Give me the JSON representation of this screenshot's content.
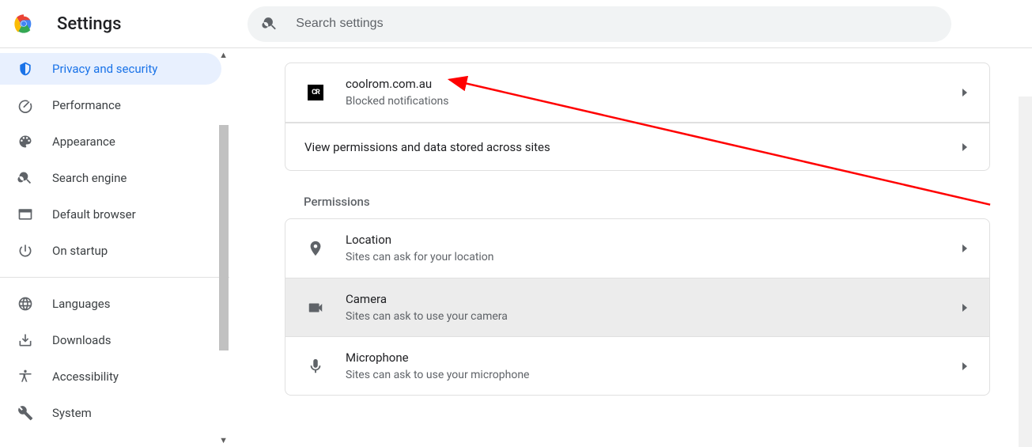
{
  "header": {
    "title": "Settings",
    "search_placeholder": "Search settings"
  },
  "sidebar": {
    "items": [
      {
        "id": "privacy",
        "label": "Privacy and security",
        "selected": true,
        "icon": "shield"
      },
      {
        "id": "performance",
        "label": "Performance",
        "selected": false,
        "icon": "speed"
      },
      {
        "id": "appearance",
        "label": "Appearance",
        "selected": false,
        "icon": "palette"
      },
      {
        "id": "search-engine",
        "label": "Search engine",
        "selected": false,
        "icon": "search"
      },
      {
        "id": "default-browser",
        "label": "Default browser",
        "selected": false,
        "icon": "browser"
      },
      {
        "id": "on-startup",
        "label": "On startup",
        "selected": false,
        "icon": "power"
      }
    ],
    "items2": [
      {
        "id": "languages",
        "label": "Languages",
        "icon": "globe"
      },
      {
        "id": "downloads",
        "label": "Downloads",
        "icon": "download"
      },
      {
        "id": "accessibility",
        "label": "Accessibility",
        "icon": "accessibility"
      },
      {
        "id": "system",
        "label": "System",
        "icon": "wrench"
      }
    ]
  },
  "recent_activity": {
    "site": {
      "domain": "coolrom.com.au",
      "status": "Blocked notifications"
    },
    "view_all_label": "View permissions and data stored across sites"
  },
  "permissions": {
    "heading": "Permissions",
    "items": [
      {
        "id": "location",
        "title": "Location",
        "sub": "Sites can ask for your location",
        "icon": "location",
        "hovered": false
      },
      {
        "id": "camera",
        "title": "Camera",
        "sub": "Sites can ask to use your camera",
        "icon": "camera",
        "hovered": true
      },
      {
        "id": "microphone",
        "title": "Microphone",
        "sub": "Sites can ask to use your microphone",
        "icon": "mic",
        "hovered": false
      }
    ]
  }
}
